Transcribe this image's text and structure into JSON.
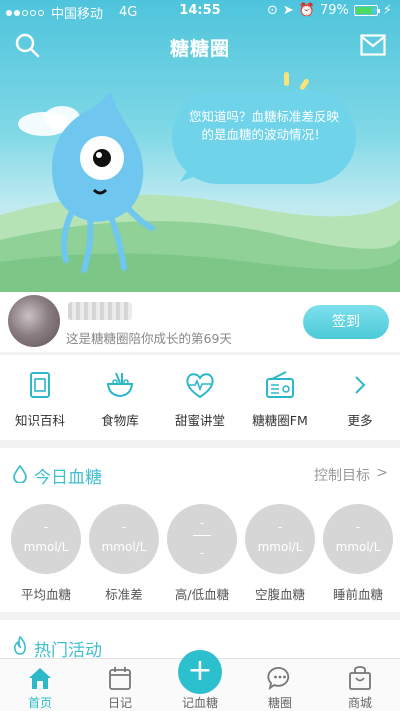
{
  "status_bar": {
    "carrier": "中国移动",
    "network": "4G",
    "time": "14:55",
    "battery_percent": "79%",
    "battery_level": 0.79
  },
  "header": {
    "title": "糖糖圈"
  },
  "hero": {
    "bubble_text": "您知道吗？血糖标准差反映的是血糖的波动情况！"
  },
  "user": {
    "days_text": "这是糖糖圈陪你成长的第69天",
    "checkin_label": "签到"
  },
  "shortcuts": [
    {
      "label": "知识百科",
      "icon": "book-icon"
    },
    {
      "label": "食物库",
      "icon": "food-bowl-icon"
    },
    {
      "label": "甜蜜讲堂",
      "icon": "heart-pulse-icon"
    },
    {
      "label": "糖糖圈FM",
      "icon": "radio-icon"
    },
    {
      "label": "更多",
      "icon": "chevron-right-icon"
    }
  ],
  "glucose": {
    "title": "今日血糖",
    "control_label": "控制目标",
    "metrics": [
      {
        "value": "-",
        "unit": "mmol/L",
        "label": "平均血糖"
      },
      {
        "value": "-",
        "unit": "mmol/L",
        "label": "标准差"
      },
      {
        "value_high": "-",
        "value_low": "-",
        "label": "高/低血糖"
      },
      {
        "value": "-",
        "unit": "mmol/L",
        "label": "空腹血糖"
      },
      {
        "value": "-",
        "unit": "mmol/L",
        "label": "睡前血糖"
      }
    ]
  },
  "activity": {
    "title": "热门活动"
  },
  "tabbar": [
    {
      "label": "首页",
      "icon": "home-icon",
      "active": true
    },
    {
      "label": "日记",
      "icon": "calendar-icon",
      "active": false
    },
    {
      "label": "记血糖",
      "icon": "plus-icon",
      "active": false
    },
    {
      "label": "糖圈",
      "icon": "chat-bubble-icon",
      "active": false
    },
    {
      "label": "商城",
      "icon": "shop-icon",
      "active": false
    }
  ],
  "colors": {
    "accent": "#2cc0cf",
    "title_accent": "#3fbfcf",
    "metric_circle": "#d6d6d6"
  }
}
